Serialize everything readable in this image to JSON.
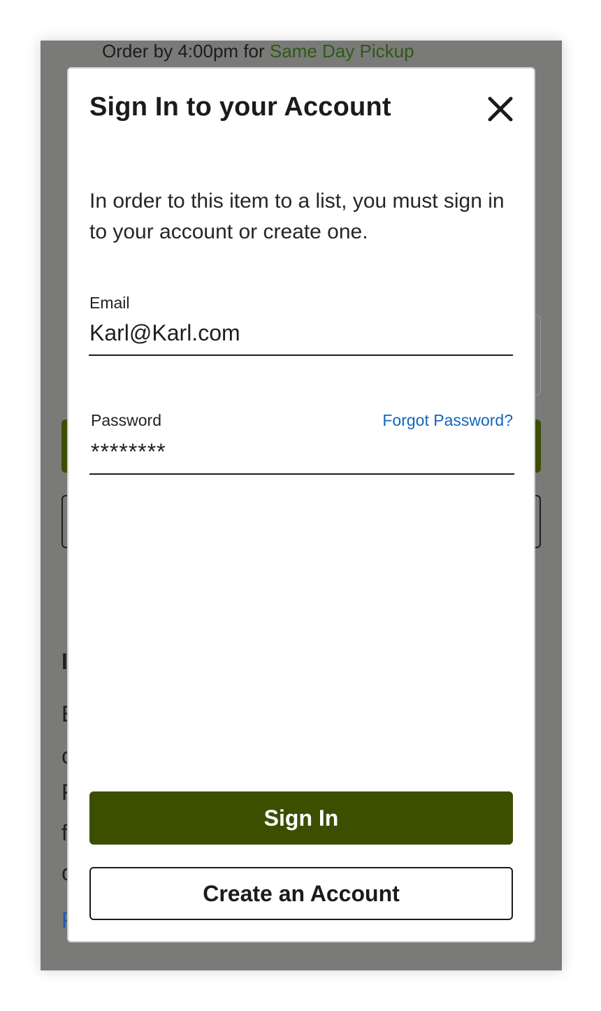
{
  "background": {
    "banner_prefix": "Order by 4:00pm for ",
    "banner_link": "Same Day Pickup",
    "fragments": [
      "I",
      "E",
      "c",
      "F",
      "f",
      "c",
      "F"
    ]
  },
  "modal": {
    "title": "Sign In to your Account",
    "intro": "In order to this item to a list, you must sign in to your account or create one.",
    "close_icon": "close-icon"
  },
  "form": {
    "email_label": "Email",
    "email_value": "Karl@Karl.com",
    "password_label": "Password",
    "password_value": "********",
    "forgot_label": "Forgot Password?"
  },
  "actions": {
    "sign_in_label": "Sign In",
    "create_account_label": "Create an Account"
  },
  "colors": {
    "primary": "#3c4f01",
    "link": "#1266bd",
    "pickup": "#2e5a16",
    "overlay": "#7a7a79"
  }
}
